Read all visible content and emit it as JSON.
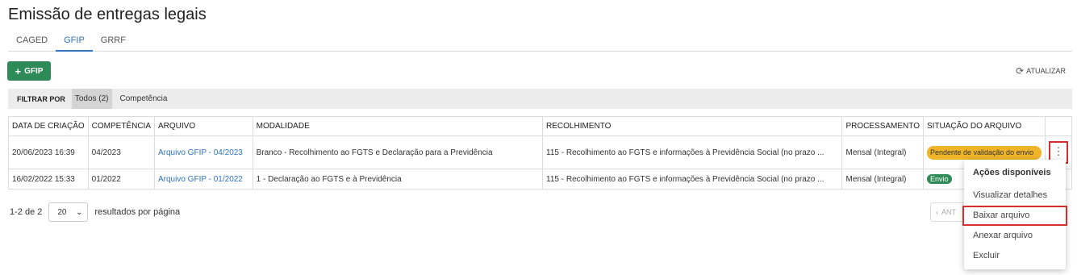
{
  "page": {
    "title": "Emissão de entregas legais"
  },
  "tabs": [
    {
      "label": "CAGED",
      "active": false
    },
    {
      "label": "GFIP",
      "active": true
    },
    {
      "label": "GRRF",
      "active": false
    }
  ],
  "toolbar": {
    "add_label": "GFIP",
    "refresh_label": "ATUALIZAR"
  },
  "filter": {
    "label": "FILTRAR POR",
    "options": [
      "Todos (2)",
      "Competência"
    ],
    "selected": "Todos (2)"
  },
  "table": {
    "columns": [
      "DATA DE CRIAÇÃO",
      "COMPETÊNCIA",
      "ARQUIVO",
      "MODALIDADE",
      "RECOLHIMENTO",
      "PROCESSAMENTO",
      "SITUAÇÃO DO ARQUIVO"
    ],
    "rows": [
      {
        "data_criacao": "20/06/2023 16:39",
        "competencia": "04/2023",
        "arquivo": "Arquivo GFIP - 04/2023",
        "modalidade": "Branco - Recolhimento ao FGTS e Declaração para a Previdência",
        "recolhimento": "115 - Recolhimento ao FGTS e informações à Previdência Social (no prazo ...",
        "processamento": "Mensal (Integral)",
        "situacao": "Pendente de validação do envio"
      },
      {
        "data_criacao": "16/02/2022 15:33",
        "competencia": "01/2022",
        "arquivo": "Arquivo GFIP - 01/2022",
        "modalidade": "1 - Declaração ao FGTS e à Previdência",
        "recolhimento": "115 - Recolhimento ao FGTS e informações à Previdência Social (no prazo ...",
        "processamento": "Mensal (Integral)",
        "situacao": "Envio"
      }
    ]
  },
  "pagination": {
    "range": "1-2 de 2",
    "page_size": "20",
    "per_page_label": "resultados por página",
    "prev_label": "ANT"
  },
  "actions_menu": {
    "header": "Ações disponíveis",
    "items": [
      "Visualizar detalhes",
      "Baixar arquivo",
      "Anexar arquivo",
      "Excluir"
    ]
  },
  "colors": {
    "primary": "#2e8b57",
    "link": "#2f74c0",
    "warning": "#f0b429",
    "highlight": "#d32f2f"
  }
}
